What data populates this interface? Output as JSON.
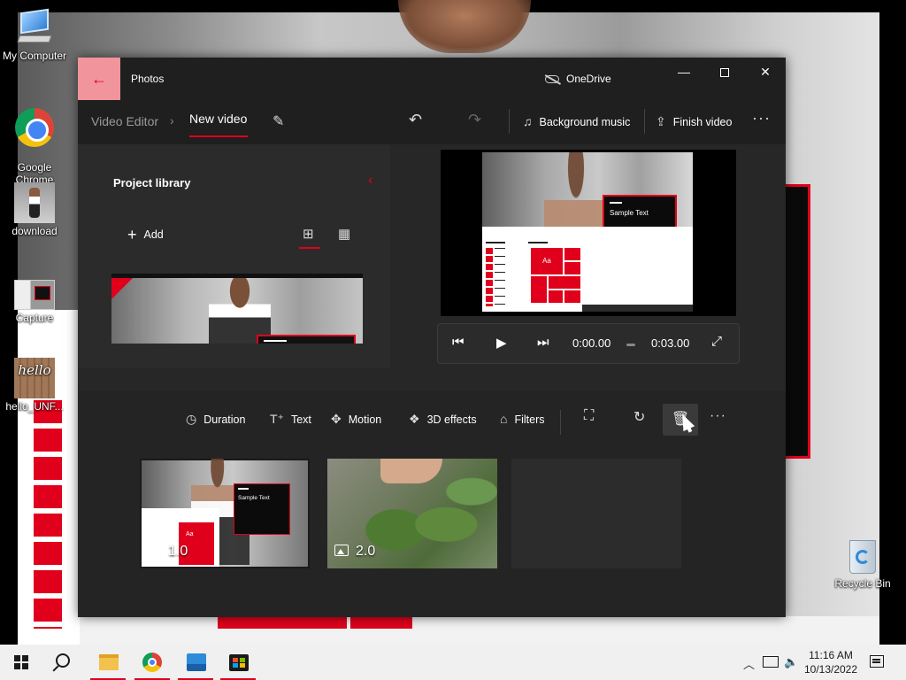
{
  "desktop": {
    "icons": [
      {
        "label": "My Computer"
      },
      {
        "label": "Google\nChrome"
      },
      {
        "label": "download"
      },
      {
        "label": "Capture"
      },
      {
        "label": "hello_UNF..."
      },
      {
        "label": "Recycle Bin"
      }
    ]
  },
  "window": {
    "app_title": "Photos",
    "back_icon": "←",
    "onedrive": "OneDrive",
    "controls": {
      "minimize": "—",
      "close": "✕"
    },
    "breadcrumb": {
      "root": "Video Editor",
      "separator": "›",
      "current": "New video"
    },
    "toolbar": {
      "background_music": "Background music",
      "finish_video": "Finish video",
      "more": "···"
    },
    "library": {
      "title": "Project library",
      "collapse": "‹",
      "add_label": "Add",
      "add_icon": "+"
    },
    "preview": {
      "sample_text": "Sample Text",
      "tile_text": "Aa"
    },
    "player": {
      "current_time": "0:00.00",
      "total_time": "0:03.00"
    },
    "storyboard": {
      "duration": "Duration",
      "text": "Text",
      "motion": "Motion",
      "effects_3d": "3D effects",
      "filters": "Filters",
      "more": "···",
      "clips": [
        {
          "duration": "1.0",
          "sample_text": "Sample Text",
          "tile_text": "Aa"
        },
        {
          "duration": "2.0"
        }
      ]
    }
  },
  "taskbar": {
    "time": "11:16 AM",
    "date": "10/13/2022"
  },
  "colors": {
    "accent": "#e0001b",
    "window_bg": "#272727",
    "titlebar_bg": "#1f1f1f",
    "taskbar_bg": "#f0f0f0"
  }
}
